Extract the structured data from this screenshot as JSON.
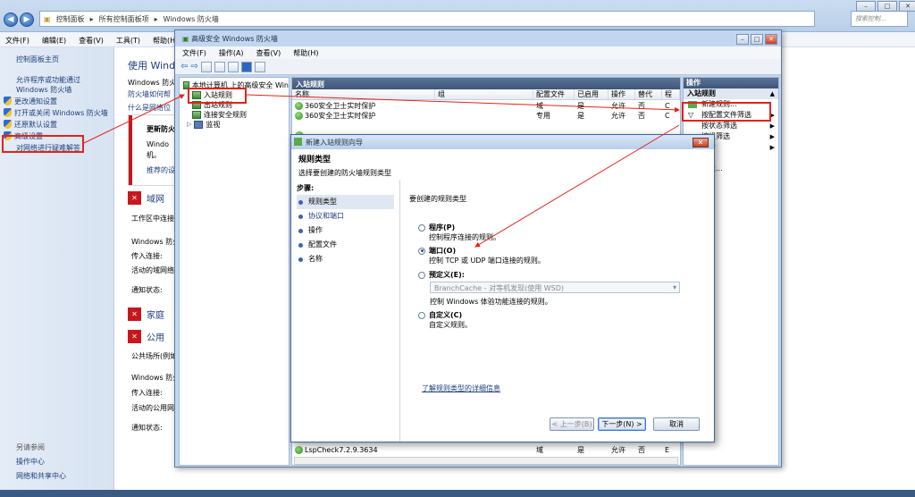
{
  "cp": {
    "breadcrumb": [
      "控制面板",
      "所有控制面板项",
      "Windows 防火墙"
    ],
    "search_placeholder": "搜索控制...",
    "menu": [
      "文件(F)",
      "编辑(E)",
      "查看(V)",
      "工具(T)",
      "帮助(H)"
    ],
    "left_links": [
      "控制面板主页",
      "允许程序或功能通过 Windows 防火墙",
      "更改通知设置",
      "打开或关闭 Windows 防火墙",
      "还原默认设置",
      "高级设置",
      "对网络进行疑难解答"
    ],
    "see_also": "另请参阅",
    "bottom_links": [
      "操作中心",
      "网络和共享中心"
    ],
    "main_title": "使用 Windo",
    "main_text1": "Windows 防火",
    "main_text2": "防火墙如何帮",
    "main_text3": "什么是网络位",
    "update_title": "更新防火",
    "update_text": "Windo",
    "update_text2": "机。",
    "update_link": "推荐的设",
    "domain_label": "域网",
    "work_text": "工作区中连接",
    "fw_status": "Windows 防火",
    "incoming": "传入连接:",
    "active_domain": "活动的域网络",
    "notify": "通知状态:",
    "home_label": "家庭",
    "public_label": "公用",
    "public_text": "公共场所(例如",
    "active_public": "活动的公用网络"
  },
  "adv": {
    "title": "高级安全 Windows 防火墙",
    "menu": [
      "文件(F)",
      "操作(A)",
      "查看(V)",
      "帮助(H)"
    ],
    "tree": [
      "本地计算机 上的高级安全 Win",
      "入站规则",
      "出站规则",
      "连接安全规则",
      "监视"
    ],
    "center_title": "入站规则",
    "columns": [
      "名称",
      "组",
      "配置文件",
      "已启用",
      "操作",
      "替代",
      "程"
    ],
    "rows": [
      [
        "360安全卫士实时保护",
        "",
        "域",
        "是",
        "允许",
        "否",
        "C"
      ],
      [
        "360安全卫士实时保护",
        "",
        "专用",
        "是",
        "允许",
        "否",
        "C"
      ]
    ],
    "last_row": [
      "LspCheck7.2.9.3634",
      "",
      "域",
      "是",
      "允许",
      "否",
      "E"
    ],
    "actions_header": "操作",
    "actions_sub": "入站规则",
    "actions": [
      "新建规则...",
      "按配置文件筛选",
      "按状态筛选",
      "按组筛选",
      "查看",
      "",
      "列表..."
    ]
  },
  "wiz": {
    "title": "新建入站规则向导",
    "heading": "规则类型",
    "subheading": "选择要创建的防火墙规则类型",
    "steps_label": "步骤:",
    "steps": [
      "规则类型",
      "协议和端口",
      "操作",
      "配置文件",
      "名称"
    ],
    "question": "要创建的规则类型",
    "options": [
      {
        "label": "程序(P)",
        "desc": "控制程序连接的规则。",
        "selected": false
      },
      {
        "label": "端口(O)",
        "desc": "控制 TCP 或 UDP 端口连接的规则。",
        "selected": true
      },
      {
        "label": "预定义(E):",
        "desc": "控制 Windows 体验功能连接的规则。",
        "selected": false
      },
      {
        "label": "自定义(C)",
        "desc": "自定义规则。",
        "selected": false
      }
    ],
    "predefined_value": "BranchCache - 对等机发现(使用 WSD)",
    "learn_more": "了解规则类型的详细信息",
    "buttons": {
      "back": "< 上一步(B)",
      "next": "下一步(N) >",
      "cancel": "取消"
    }
  }
}
